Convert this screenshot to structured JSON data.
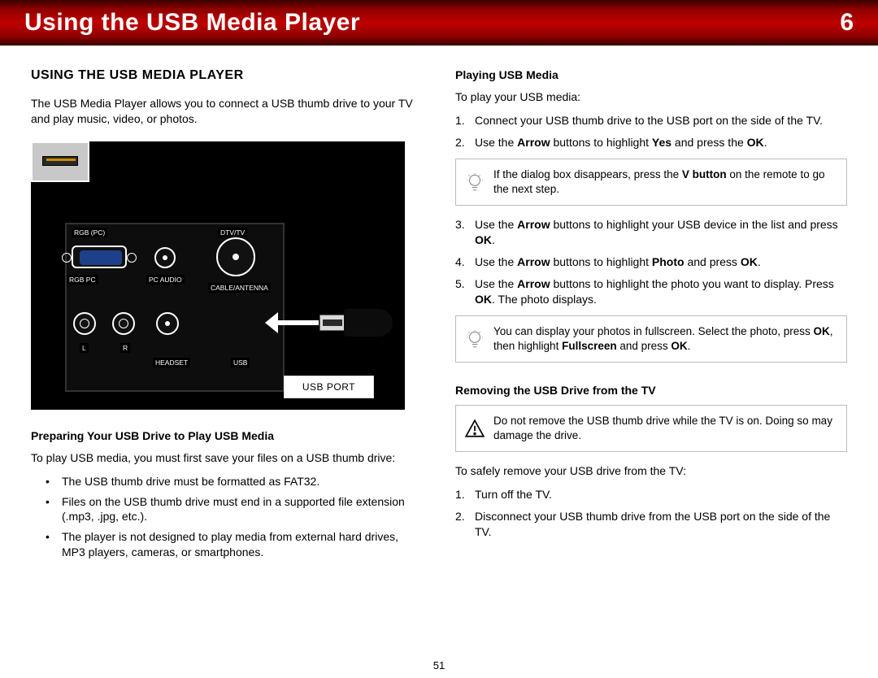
{
  "header": {
    "title": "Using the USB Media Player",
    "chapter": "6"
  },
  "left": {
    "section_title": "USING THE USB MEDIA PLAYER",
    "intro": "The USB Media Player allows you to connect a USB thumb drive to your TV and play music, video, or photos.",
    "figure": {
      "caption": "USB PORT",
      "labels": {
        "rgb_pc_top": "RGB (PC)",
        "dtv_tv": "DTV/TV",
        "rgb_pc": "RGB PC",
        "pc_audio": "PC AUDIO",
        "cable_antenna": "CABLE/ANTENNA",
        "l": "L",
        "r": "R",
        "headset": "HEADSET",
        "usb": "USB"
      }
    },
    "preparing": {
      "heading": "Preparing Your USB Drive to Play USB Media",
      "lead": "To play USB media, you must first save your files on a USB thumb drive:",
      "bullets": [
        "The USB thumb drive must be formatted as FAT32.",
        "Files on the USB thumb drive must end in a supported file extension (.mp3, .jpg, etc.).",
        "The player is not designed to play media from external hard drives, MP3 players, cameras, or smartphones."
      ]
    }
  },
  "right": {
    "playing": {
      "heading": "Playing USB Media",
      "lead": "To play your USB media:",
      "step1": "Connect your USB thumb drive to the USB port on the side of the TV.",
      "step2_a": "Use the ",
      "step2_b": "Arrow",
      "step2_c": " buttons to highlight ",
      "step2_d": "Yes",
      "step2_e": " and press the ",
      "step2_f": "OK",
      "step2_g": ".",
      "tip1_a": "If the dialog box disappears, press the ",
      "tip1_b": "V button",
      "tip1_c": " on the remote to go the next step.",
      "step3_a": "Use the ",
      "step3_b": "Arrow",
      "step3_c": " buttons to highlight your USB device in the list and press ",
      "step3_d": "OK",
      "step3_e": ".",
      "step4_a": "Use the ",
      "step4_b": "Arrow",
      "step4_c": " buttons to highlight ",
      "step4_d": "Photo",
      "step4_e": " and press ",
      "step4_f": "OK",
      "step4_g": ".",
      "step5_a": "Use the ",
      "step5_b": "Arrow",
      "step5_c": " buttons to highlight the photo you want to display. Press ",
      "step5_d": "OK",
      "step5_e": ". The photo displays.",
      "tip2_a": "You can display your photos in fullscreen. Select the photo, press ",
      "tip2_b": "OK",
      "tip2_c": ", then highlight ",
      "tip2_d": "Fullscreen",
      "tip2_e": " and press ",
      "tip2_f": "OK",
      "tip2_g": "."
    },
    "removing": {
      "heading": "Removing the USB Drive from the TV",
      "warn": "Do not remove the USB thumb drive while the TV is on. Doing so may damage the drive.",
      "lead": "To safely remove your USB drive from the TV:",
      "step1": "Turn off the TV.",
      "step2": "Disconnect your USB thumb drive from the USB port on the side of the TV."
    }
  },
  "page_number": "51"
}
